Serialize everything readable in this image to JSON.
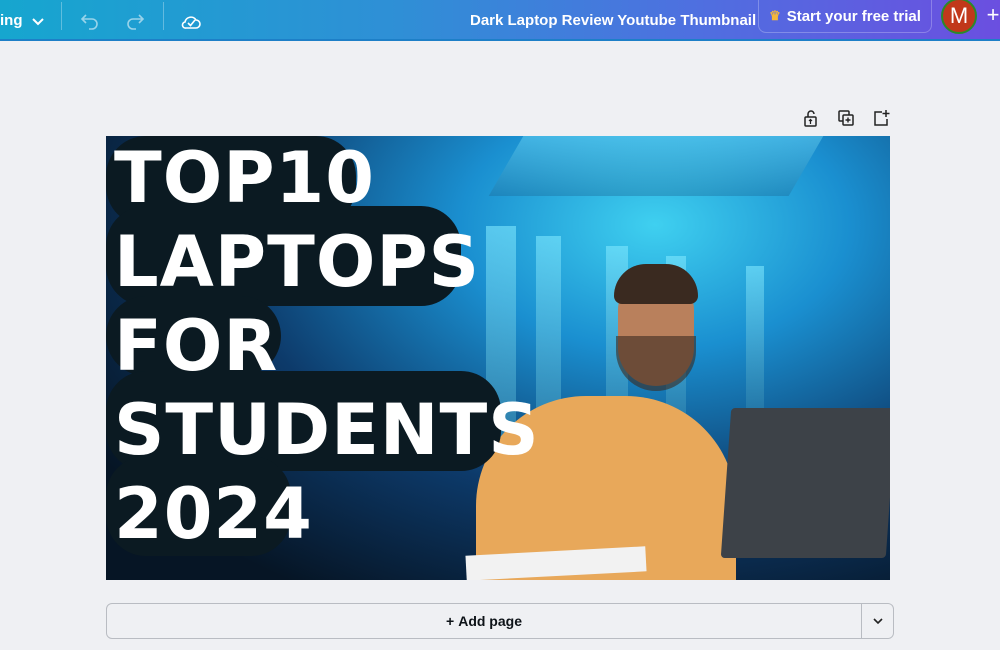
{
  "topbar": {
    "menu_partial": "ing",
    "title": "Dark Laptop Review Youtube Thumbnail",
    "trial_label": "Start your free trial",
    "avatar_initial": "M",
    "plus": "+"
  },
  "canvas": {
    "title_lines": [
      "TOP10",
      "LAPTOPS",
      "FOR",
      "STUDENTS",
      "2024"
    ]
  },
  "footer": {
    "add_page_label": "Add page",
    "add_page_icon": "+"
  }
}
